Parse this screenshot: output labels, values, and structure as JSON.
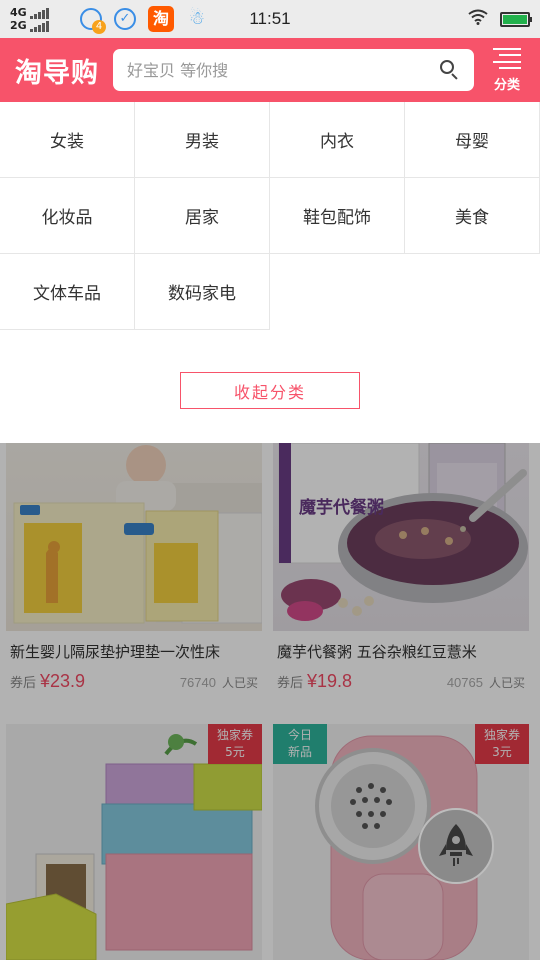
{
  "status_bar": {
    "network_top": "4G",
    "network_bottom": "2G",
    "notification_badge": "4",
    "taobao_icon_text": "淘",
    "time": "11:51"
  },
  "header": {
    "logo": "淘导购",
    "search_placeholder": "好宝贝 等你搜",
    "category_label": "分类",
    "brand_color": "#f7536a"
  },
  "categories": {
    "rows": [
      [
        "女装",
        "男装",
        "内衣",
        "母婴"
      ],
      [
        "化妆品",
        "居家",
        "鞋包配饰",
        "美食"
      ],
      [
        "文体车品",
        "数码家电"
      ]
    ],
    "collapse_label": "收起分类"
  },
  "products": [
    {
      "title": "新生婴儿隔尿垫护理垫一次性床",
      "coupon_label": "券后",
      "price": "¥23.9",
      "sales": "76740",
      "sales_unit": "人已买"
    },
    {
      "title": "魔芋代餐粥 五谷杂粮红豆薏米",
      "coupon_label": "券后",
      "price": "¥19.8",
      "sales": "40765",
      "sales_unit": "人已买",
      "image_text": "魔芋代餐粥"
    },
    {
      "tag_line1": "独家券",
      "tag_line2": "5元"
    },
    {
      "tag_left_line1": "今日",
      "tag_left_line2": "新品",
      "tag_line1": "独家券",
      "tag_line2": "3元"
    }
  ]
}
